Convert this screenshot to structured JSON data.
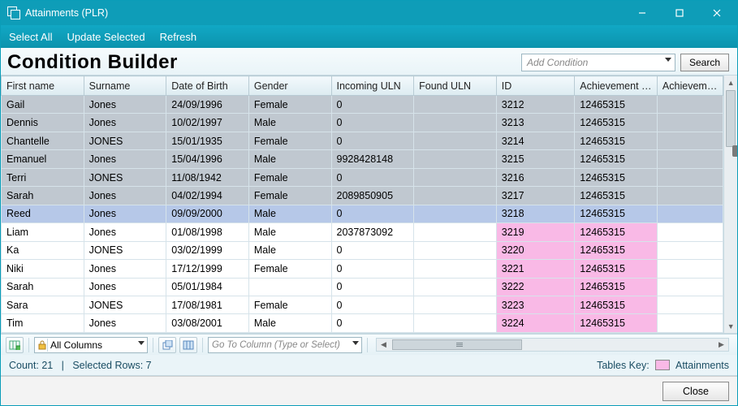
{
  "window": {
    "title": "Attainments (PLR)",
    "minimize": "Minimize",
    "maximize": "Maximize",
    "close": "Close"
  },
  "menubar": {
    "select_all": "Select All",
    "update_selected": "Update Selected",
    "refresh": "Refresh"
  },
  "header": {
    "title": "Condition Builder",
    "condition_placeholder": "Add Condition",
    "search_label": "Search"
  },
  "columns": {
    "first_name": "First name",
    "surname": "Surname",
    "dob": "Date of Birth",
    "gender": "Gender",
    "incoming_uln": "Incoming ULN",
    "found_uln": "Found ULN",
    "id": "ID",
    "ach_pr": "Achievement Pr...",
    "ach": "Achievement"
  },
  "rows": [
    {
      "first": "Gail",
      "sur": "Jones",
      "dob": "24/09/1996",
      "gen": "Female",
      "inc": "0",
      "found": "",
      "id": "3212",
      "ach": "12465315",
      "sel": true,
      "pink": false
    },
    {
      "first": "Dennis",
      "sur": "Jones",
      "dob": "10/02/1997",
      "gen": "Male",
      "inc": "0",
      "found": "",
      "id": "3213",
      "ach": "12465315",
      "sel": true,
      "pink": false
    },
    {
      "first": "Chantelle",
      "sur": "JONES",
      "dob": "15/01/1935",
      "gen": "Female",
      "inc": "0",
      "found": "",
      "id": "3214",
      "ach": "12465315",
      "sel": true,
      "pink": false
    },
    {
      "first": "Emanuel",
      "sur": "Jones",
      "dob": "15/04/1996",
      "gen": "Male",
      "inc": "9928428148",
      "found": "",
      "id": "3215",
      "ach": "12465315",
      "sel": true,
      "pink": false
    },
    {
      "first": "Terri",
      "sur": "JONES",
      "dob": "11/08/1942",
      "gen": "Female",
      "inc": "0",
      "found": "",
      "id": "3216",
      "ach": "12465315",
      "sel": true,
      "pink": false
    },
    {
      "first": "Sarah",
      "sur": "Jones",
      "dob": "04/02/1994",
      "gen": "Female",
      "inc": "2089850905",
      "found": "",
      "id": "3217",
      "ach": "12465315",
      "sel": true,
      "pink": false
    },
    {
      "first": "Reed",
      "sur": "Jones",
      "dob": "09/09/2000",
      "gen": "Male",
      "inc": "0",
      "found": "",
      "id": "3218",
      "ach": "12465315",
      "sel": true,
      "pink": false,
      "active": true
    },
    {
      "first": "Liam",
      "sur": "Jones",
      "dob": "01/08/1998",
      "gen": "Male",
      "inc": "2037873092",
      "found": "",
      "id": "3219",
      "ach": "12465315",
      "sel": false,
      "pink": true
    },
    {
      "first": "Ka",
      "sur": "JONES",
      "dob": "03/02/1999",
      "gen": "Male",
      "inc": "0",
      "found": "",
      "id": "3220",
      "ach": "12465315",
      "sel": false,
      "pink": true
    },
    {
      "first": "Niki",
      "sur": "Jones",
      "dob": "17/12/1999",
      "gen": "Female",
      "inc": "0",
      "found": "",
      "id": "3221",
      "ach": "12465315",
      "sel": false,
      "pink": true
    },
    {
      "first": "Sarah",
      "sur": "Jones",
      "dob": "05/01/1984",
      "gen": "",
      "inc": "0",
      "found": "",
      "id": "3222",
      "ach": "12465315",
      "sel": false,
      "pink": true
    },
    {
      "first": "Sara",
      "sur": "JONES",
      "dob": "17/08/1981",
      "gen": "Female",
      "inc": "0",
      "found": "",
      "id": "3223",
      "ach": "12465315",
      "sel": false,
      "pink": true
    },
    {
      "first": "Tim",
      "sur": "Jones",
      "dob": "03/08/2001",
      "gen": "Male",
      "inc": "0",
      "found": "",
      "id": "3224",
      "ach": "12465315",
      "sel": false,
      "pink": true
    }
  ],
  "toolstrip": {
    "all_columns": "All Columns",
    "goto_placeholder": "Go To Column (Type or Select)"
  },
  "status": {
    "count_label": "Count:",
    "count": "21",
    "sep": "|",
    "selected_label": "Selected Rows:",
    "selected": "7",
    "key_label": "Tables Key:",
    "key_attainments": "Attainments"
  },
  "bottom": {
    "close": "Close"
  }
}
